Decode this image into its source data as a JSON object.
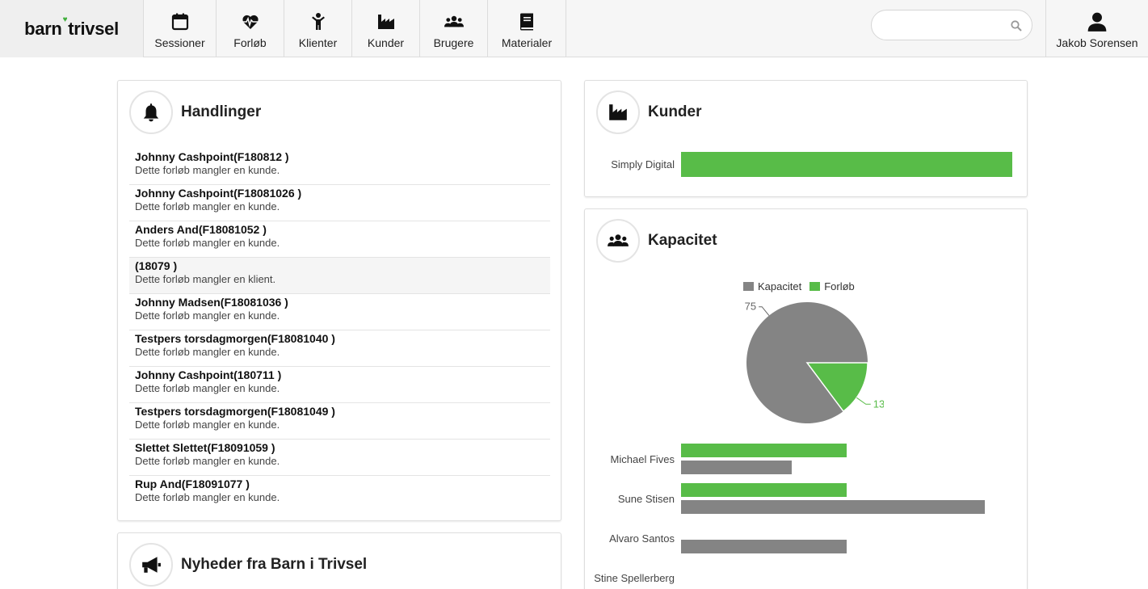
{
  "app": {
    "logo_left": "barn",
    "logo_right": "trivsel",
    "brand_color": "#58bc48"
  },
  "nav": {
    "items": [
      {
        "label": "Sessioner",
        "icon": "calendar-icon"
      },
      {
        "label": "Forløb",
        "icon": "heartbeat-icon"
      },
      {
        "label": "Klienter",
        "icon": "child-icon"
      },
      {
        "label": "Kunder",
        "icon": "factory-icon"
      },
      {
        "label": "Brugere",
        "icon": "users-icon"
      },
      {
        "label": "Materialer",
        "icon": "book-icon"
      }
    ],
    "search_placeholder": "",
    "user_name": "Jakob Sorensen"
  },
  "handlinger": {
    "title": "Handlinger",
    "items": [
      {
        "title": "Johnny Cashpoint(F180812 )",
        "sub": "Dette forløb mangler en kunde."
      },
      {
        "title": "Johnny Cashpoint(F18081026 )",
        "sub": "Dette forløb mangler en kunde."
      },
      {
        "title": "Anders And(F18081052 )",
        "sub": "Dette forløb mangler en kunde."
      },
      {
        "title": "(18079 )",
        "sub": "Dette forløb mangler en klient."
      },
      {
        "title": "Johnny Madsen(F18081036 )",
        "sub": "Dette forløb mangler en kunde."
      },
      {
        "title": "Testpers torsdagmorgen(F18081040 )",
        "sub": "Dette forløb mangler en kunde."
      },
      {
        "title": "Johnny Cashpoint(180711 )",
        "sub": "Dette forløb mangler en kunde."
      },
      {
        "title": "Testpers torsdagmorgen(F18081049 )",
        "sub": "Dette forløb mangler en kunde."
      },
      {
        "title": "Slettet Slettet(F18091059 )",
        "sub": "Dette forløb mangler en kunde."
      },
      {
        "title": "Rup And(F18091077 )",
        "sub": "Dette forløb mangler en kunde."
      }
    ]
  },
  "nyheder": {
    "title": "Nyheder fra Barn i Trivsel"
  },
  "kunder": {
    "title": "Kunder"
  },
  "kapacitet": {
    "title": "Kapacitet"
  },
  "chart_data": [
    {
      "type": "bar",
      "orientation": "horizontal",
      "categories": [
        "Simply Digital"
      ],
      "series": [
        {
          "values": [
            1
          ],
          "color": "#58bc48"
        }
      ],
      "xlim": [
        0,
        1
      ]
    },
    {
      "type": "pie",
      "legend_position": "top",
      "labels": [
        "Kapacitet",
        "Forløb"
      ],
      "values": [
        75,
        13
      ],
      "colors": [
        "#848484",
        "#58bc48"
      ]
    },
    {
      "type": "bar",
      "orientation": "horizontal",
      "categories": [
        "Michael Fives",
        "Sune Stisen",
        "Alvaro Santos",
        "Stine Spellerberg"
      ],
      "series": [
        {
          "name": "Forløb",
          "values": [
            6,
            6,
            0,
            0
          ],
          "color": "#58bc48"
        },
        {
          "name": "Kapacitet",
          "values": [
            4,
            11,
            6,
            0
          ],
          "color": "#848484"
        }
      ],
      "xlim": [
        0,
        12
      ]
    }
  ]
}
